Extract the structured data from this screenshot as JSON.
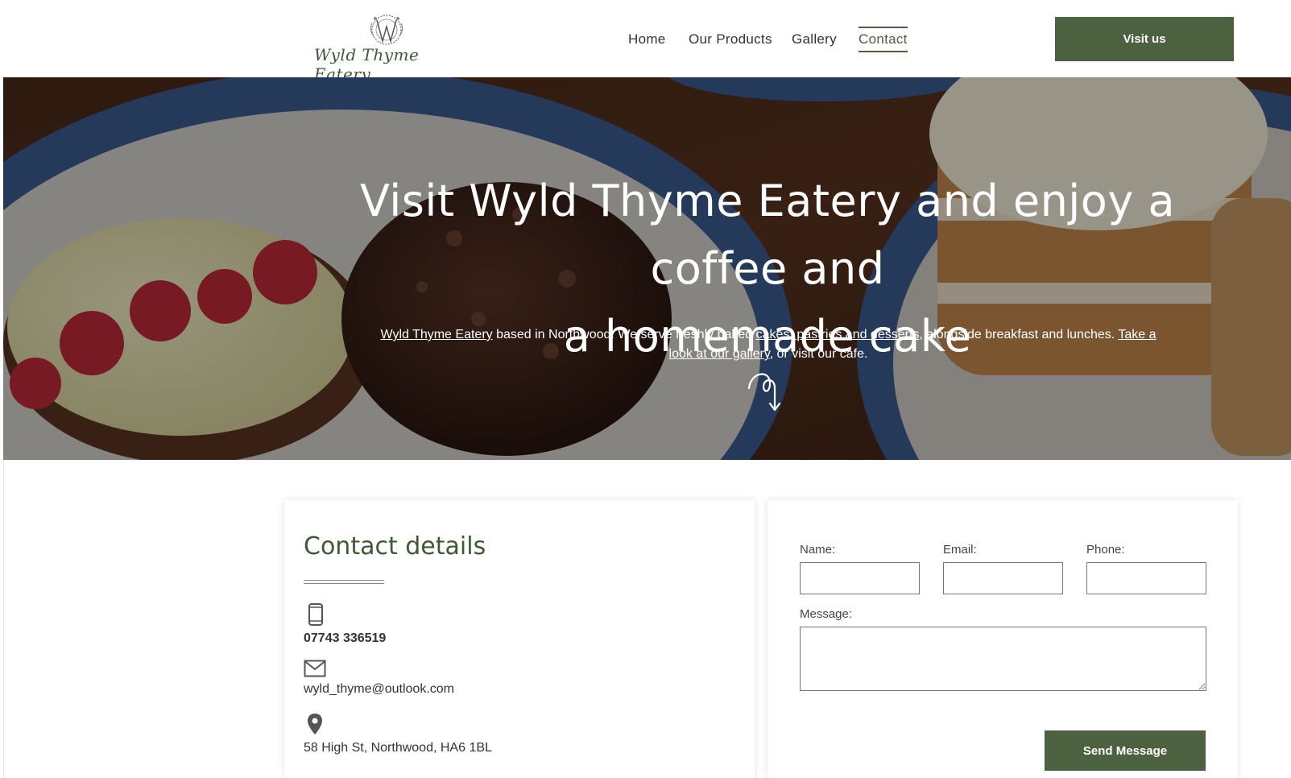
{
  "brand": {
    "name": "Wyld Thyme Eatery"
  },
  "nav": {
    "items": [
      {
        "label": "Home"
      },
      {
        "label": "Our Products"
      },
      {
        "label": "Gallery"
      },
      {
        "label": "Contact",
        "active": true
      }
    ],
    "cta_label": "Visit us"
  },
  "hero": {
    "title_line1": "Visit Wyld Thyme Eatery and enjoy a coffee and",
    "title_line2": "a homemade cake",
    "text_link1": "Wyld Thyme Eatery",
    "text_part1": " based in Northwood. We serve freshly baked ",
    "text_link2": "cakes, pastries and desserts",
    "text_part2": ", alongside breakfast and lunches. ",
    "text_link3": "Take a look at our gallery",
    "text_part3": ", or visit our cafe."
  },
  "contact": {
    "title": "Contact details",
    "phone": "07743 336519",
    "email": "wyld_thyme@outlook.com",
    "address": "58 High St, Northwood, HA6 1BL"
  },
  "form": {
    "name_label": "Name:",
    "email_label": "Email:",
    "phone_label": "Phone:",
    "message_label": "Message:",
    "send_label": "Send Message"
  },
  "colors": {
    "accent": "#4c6140",
    "brand_text": "#3e5a34"
  }
}
